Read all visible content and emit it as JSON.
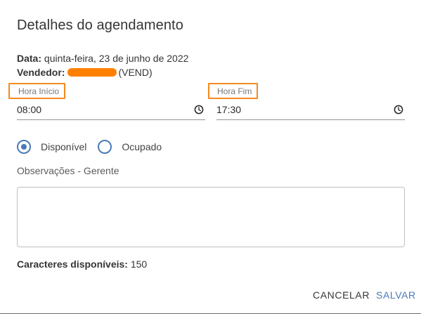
{
  "dialog": {
    "title": "Detalhes do agendamento"
  },
  "info": {
    "data_label": "Data:",
    "data_value": "quinta-feira, 23 de junho de 2022",
    "vendedor_label": "Vendedor:",
    "vendedor_suffix": "(VEND)"
  },
  "fields": {
    "hora_inicio": {
      "label": "Hora Início",
      "value": "08:00"
    },
    "hora_fim": {
      "label": "Hora Fim",
      "value": "17:30"
    }
  },
  "status": {
    "options": [
      {
        "label": "Disponível",
        "selected": true
      },
      {
        "label": "Ocupado",
        "selected": false
      }
    ]
  },
  "observacoes": {
    "label": "Observações - Gerente",
    "value": ""
  },
  "chars": {
    "label": "Caracteres disponíveis:",
    "value": "150"
  },
  "actions": {
    "cancel_label": "CANCELAR",
    "save_label": "SALVAR"
  },
  "colors": {
    "accent": "#4a7ab8",
    "highlight": "#f5891f",
    "redaction": "#ff8000"
  },
  "icons": {
    "time": "clock-icon",
    "radio_checked": "radio-checked-icon",
    "radio_unchecked": "radio-unchecked-icon"
  }
}
